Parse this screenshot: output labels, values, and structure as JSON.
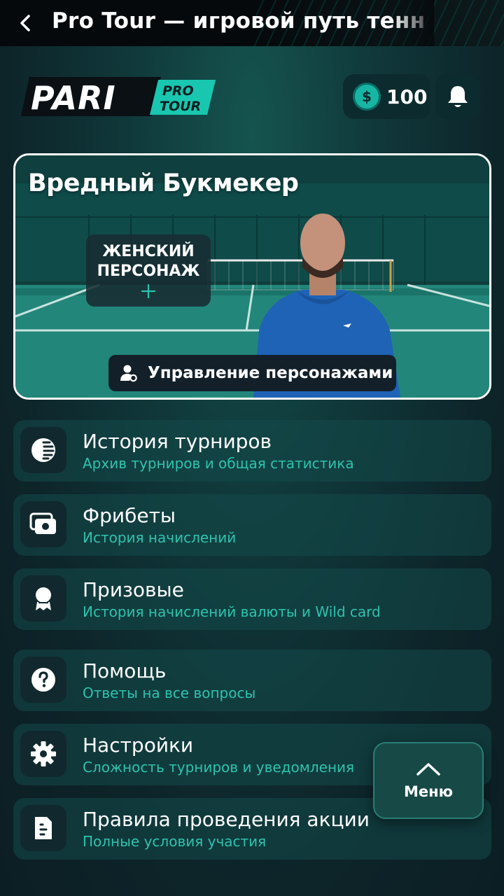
{
  "topbar": {
    "title": "Pro Tour — игровой путь тенн",
    "back_icon": "chevron-left-icon"
  },
  "header": {
    "logo_text": "PARI",
    "logo_badge_line1": "PRO",
    "logo_badge_line2": "TOUR",
    "coin_symbol": "$",
    "coins": "100",
    "bell_icon": "bell-icon"
  },
  "character_card": {
    "title": "Вредный Букмекер",
    "female_slot_label": "ЖЕНСКИЙ ПЕРСОНАЖ",
    "manage_button_label": "Управление персонажами"
  },
  "menu": {
    "items": [
      {
        "icon": "history-icon",
        "title": "История турниров",
        "subtitle": "Архив турниров и общая статистика"
      },
      {
        "icon": "freebets-icon",
        "title": "Фрибеты",
        "subtitle": "История начислений"
      },
      {
        "icon": "prize-icon",
        "title": "Призовые",
        "subtitle": "История начислений валюты и Wild card"
      },
      {
        "icon": "help-icon",
        "title": "Помощь",
        "subtitle": "Ответы на все вопросы"
      },
      {
        "icon": "settings-icon",
        "title": "Настройки",
        "subtitle": "Сложность турниров и уведомления"
      },
      {
        "icon": "rules-icon",
        "title": "Правила проведения акции",
        "subtitle": "Полные условия участия"
      }
    ]
  },
  "fab": {
    "label": "Меню",
    "icon": "chevron-up-icon"
  },
  "colors": {
    "accent": "#2ec3ad",
    "background": "#0d2429",
    "coin": "#17b6a4"
  }
}
